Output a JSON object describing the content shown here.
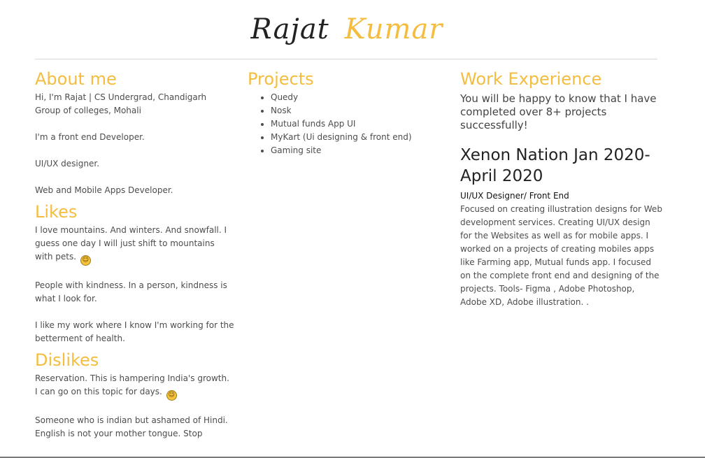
{
  "header": {
    "first_name": "Rajat",
    "last_name": "Kumar"
  },
  "about": {
    "title": "About me",
    "paragraphs": [
      "Hi, I'm Rajat | CS Undergrad, Chandigarh Group of colleges, Mohali",
      "I'm a front end Developer.",
      "UI/UX designer.",
      "Web and Mobile Apps Developer."
    ]
  },
  "likes": {
    "title": "Likes",
    "paragraphs": [
      "I love mountains. And winters. And snowfall. I guess one day I will just shift to mountains with pets.",
      "People with kindness. In a person, kindness is what I look for.",
      "I like my work where I know I'm working for the betterment of health."
    ]
  },
  "dislikes": {
    "title": "Dislikes",
    "paragraphs": [
      "Reservation. This is hampering India's growth. I can go on this topic for days.",
      "Someone who is indian but ashamed of Hindi. English is not your mother tongue. Stop"
    ]
  },
  "projects": {
    "title": "Projects",
    "items": [
      "Quedy",
      "Nosk",
      "Mutual funds App UI",
      "MyKart (Ui designing & front end)",
      "Gaming site"
    ]
  },
  "work": {
    "title": "Work Experience",
    "intro": "You will be happy to know that I have completed over 8+ projects successfully!",
    "job_title": "Xenon Nation Jan 2020-April 2020",
    "role": "UI/UX Designer/ Front End",
    "description": "Focused on creating illustration designs for Web development services. Creating UI/UX design for the Websites as well as for mobile apps. I worked on a projects of creating mobiles apps like Farming app, Mutual funds app. I focused on the complete front end and designing of the projects. Tools- Figma , Adobe Photoshop, Adobe XD, Adobe illustration. ."
  },
  "icons": {
    "emoji_smile": "smiley-emoji-icon"
  }
}
